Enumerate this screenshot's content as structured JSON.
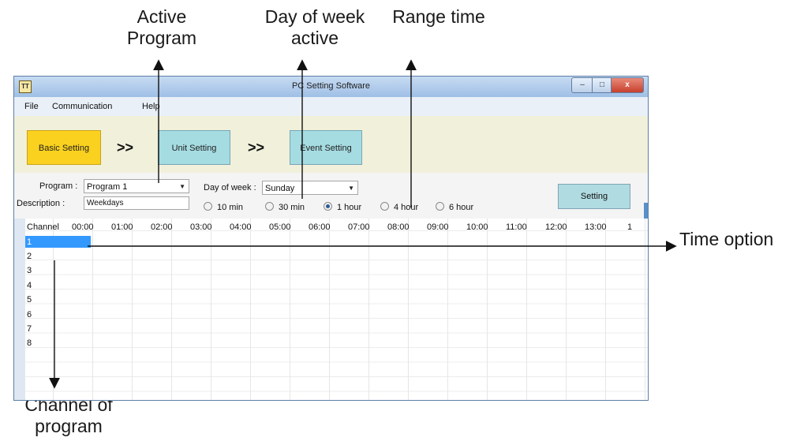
{
  "annotations": {
    "active_program": "Active Program",
    "day_of_week_active": "Day of week active",
    "range_time": "Range time",
    "time_option": "Time option",
    "channel_of_program": "Channel of program"
  },
  "window": {
    "app_icon": "TT",
    "title": "PC Setting Software",
    "controls": {
      "minimize": "–",
      "maximize": "□",
      "close": "x"
    }
  },
  "menu": {
    "file": "File",
    "communication": "Communication",
    "help": "Help"
  },
  "steps": {
    "basic": "Basic Setting",
    "unit": "Unit Setting",
    "event": "Event Setting",
    "separator": ">>"
  },
  "settings": {
    "program_label": "Program :",
    "program_value": "Program 1",
    "description_label": "Description :",
    "description_value": "Weekdays",
    "day_label": "Day of week :",
    "day_value": "Sunday",
    "ranges": [
      "10 min",
      "30 min",
      "1 hour",
      "4 hour",
      "6 hour"
    ],
    "selected_range": "1 hour",
    "setting_button": "Setting"
  },
  "grid": {
    "channel_header": "Channel",
    "columns": [
      "00:00",
      "01:00",
      "02:00",
      "03:00",
      "04:00",
      "05:00",
      "06:00",
      "07:00",
      "08:00",
      "09:00",
      "10:00",
      "11:00",
      "12:00",
      "13:00",
      "1"
    ],
    "rows": [
      "1",
      "2",
      "3",
      "4",
      "5",
      "6",
      "7",
      "8"
    ],
    "selected_row": "1"
  },
  "colors": {
    "basic_step": "#fad11e",
    "other_steps": "#a5dce2",
    "selection": "#3399ff",
    "toolstrip": "#f1f0db"
  }
}
